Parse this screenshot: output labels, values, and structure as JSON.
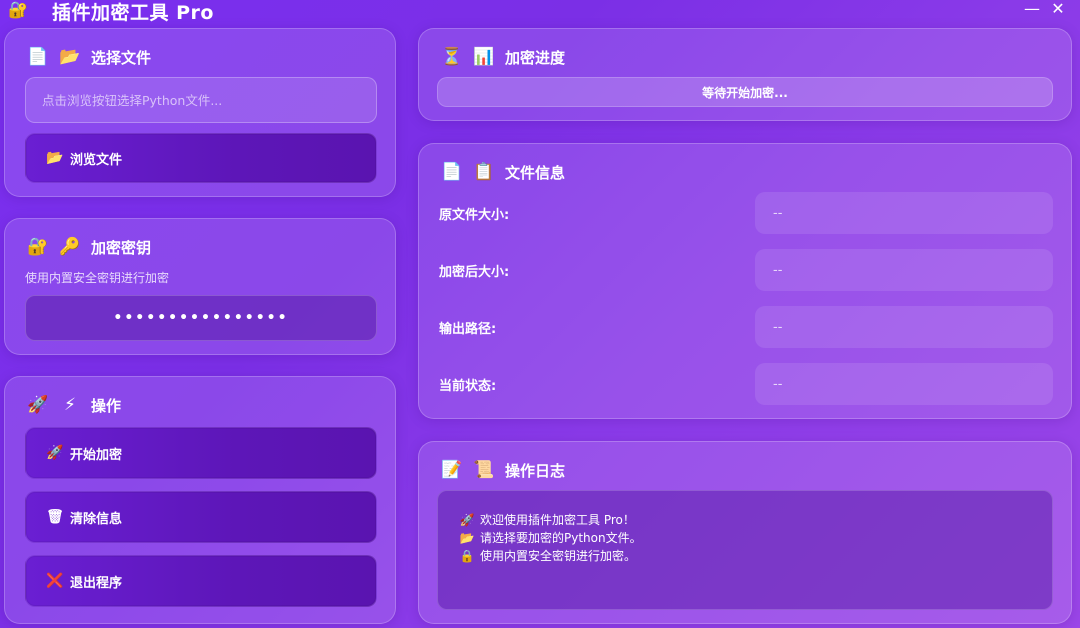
{
  "window": {
    "title": "插件加密工具 Pro",
    "app_icon": "🔐",
    "minimize": "—",
    "close": "✕"
  },
  "select_file": {
    "icons": [
      "📄",
      "📂"
    ],
    "title": "选择文件",
    "input_placeholder": "点击浏览按钮选择Python文件...",
    "input_value": "",
    "browse_icon": "📂",
    "browse_label": "浏览文件"
  },
  "encrypt_key": {
    "icons": [
      "🔐",
      "🔑"
    ],
    "title": "加密密钥",
    "description": "使用内置安全密钥进行加密",
    "masked_key": "••••••••••••••••"
  },
  "actions": {
    "icons": [
      "🚀",
      "⚡"
    ],
    "title": "操作",
    "buttons": [
      {
        "icon": "🚀",
        "label": "开始加密"
      },
      {
        "icon": "🗑",
        "label": "清除信息"
      },
      {
        "icon": "❌",
        "label": "退出程序"
      }
    ]
  },
  "progress": {
    "icons": [
      "⏳",
      "📊"
    ],
    "title": "加密进度",
    "status_text": "等待开始加密...",
    "value": 0
  },
  "file_info": {
    "icons": [
      "📄",
      "📋"
    ],
    "title": "文件信息",
    "rows": [
      {
        "label": "原文件大小:",
        "value": "--"
      },
      {
        "label": "加密后大小:",
        "value": "--"
      },
      {
        "label": "输出路径:",
        "value": "--"
      },
      {
        "label": "当前状态:",
        "value": "--"
      }
    ]
  },
  "log": {
    "icons": [
      "📝",
      "📜"
    ],
    "title": "操作日志",
    "lines": [
      {
        "icon": "🚀",
        "text": "欢迎使用插件加密工具 Pro！"
      },
      {
        "icon": "📂",
        "text": "请选择要加密的Python文件。"
      },
      {
        "icon": "🔒",
        "text": "使用内置安全密钥进行加密。"
      }
    ]
  },
  "colors": {
    "background_start": "#7a2ff0",
    "background_end": "#9b46e8",
    "button_dark": "#5d16b8"
  }
}
